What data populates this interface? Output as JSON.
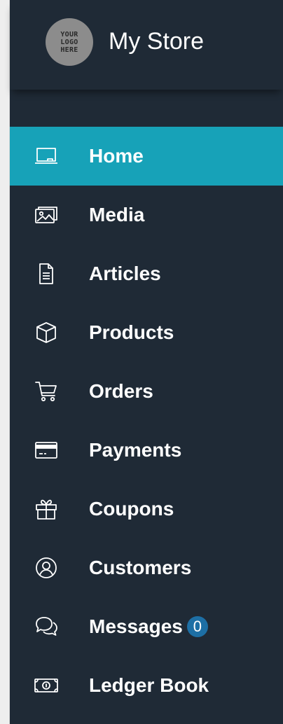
{
  "brand": {
    "logo_lines": [
      "YOUR",
      "LOGO",
      "HERE"
    ],
    "store_name": "My Store"
  },
  "nav": {
    "items": [
      {
        "label": "Home",
        "icon": "laptop-icon",
        "active": true
      },
      {
        "label": "Media",
        "icon": "images-icon"
      },
      {
        "label": "Articles",
        "icon": "document-icon"
      },
      {
        "label": "Products",
        "icon": "box-icon"
      },
      {
        "label": "Orders",
        "icon": "cart-icon"
      },
      {
        "label": "Payments",
        "icon": "credit-card-icon"
      },
      {
        "label": "Coupons",
        "icon": "gift-icon"
      },
      {
        "label": "Customers",
        "icon": "user-circle-icon"
      },
      {
        "label": "Messages",
        "icon": "chat-bubbles-icon",
        "badge": "0"
      },
      {
        "label": "Ledger Book",
        "icon": "money-bill-icon"
      }
    ]
  },
  "colors": {
    "sidebar_bg": "#1f2a36",
    "active_bg": "#17a2b8",
    "badge_bg": "#1d6fa5",
    "text": "#ffffff"
  }
}
